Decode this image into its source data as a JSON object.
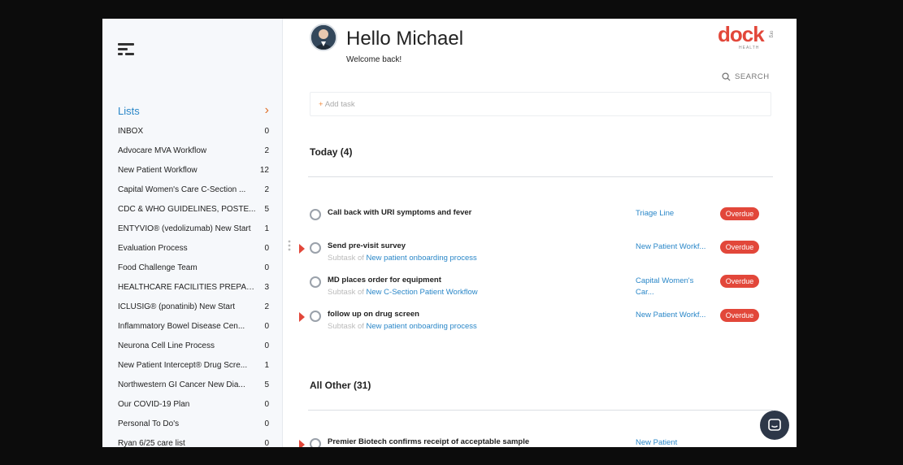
{
  "sidebar": {
    "lists_label": "Lists",
    "items": [
      {
        "name": "INBOX",
        "count": "0"
      },
      {
        "name": "Advocare MVA Workflow",
        "count": "2"
      },
      {
        "name": "New Patient Workflow",
        "count": "12"
      },
      {
        "name": "Capital Women's Care C-Section ...",
        "count": "2"
      },
      {
        "name": "CDC & WHO GUIDELINES, POSTE...",
        "count": "5"
      },
      {
        "name": "ENTYVIO® (vedolizumab) New Start",
        "count": "1"
      },
      {
        "name": "Evaluation Process",
        "count": "0"
      },
      {
        "name": "Food Challenge Team",
        "count": "0"
      },
      {
        "name": "HEALTHCARE FACILITIES PREPAR...",
        "count": "3"
      },
      {
        "name": "ICLUSIG® (ponatinib) New Start",
        "count": "2"
      },
      {
        "name": "Inflammatory Bowel Disease Cen...",
        "count": "0"
      },
      {
        "name": "Neurona Cell Line Process",
        "count": "0"
      },
      {
        "name": "New Patient Intercept® Drug Scre...",
        "count": "1"
      },
      {
        "name": "Northwestern GI Cancer New Dia...",
        "count": "5"
      },
      {
        "name": "Our COVID-19 Plan",
        "count": "0"
      },
      {
        "name": "Personal To Do's",
        "count": "0"
      },
      {
        "name": "Ryan 6/25 care list",
        "count": "0"
      }
    ]
  },
  "header": {
    "greeting": "Hello Michael",
    "welcome": "Welcome back!",
    "logo_text": "dock",
    "logo_sub": "HEALTH",
    "logo_dot": "org",
    "search_label": "SEARCH",
    "add_task_plus": "+",
    "add_task_label": "Add task"
  },
  "sections": {
    "today": "Today (4)",
    "all_other": "All Other (31)"
  },
  "tasks": [
    {
      "title": "Call back with URI symptoms and fever",
      "subtask_prefix": "",
      "subtask_link": "",
      "list": "Triage Line",
      "status": "Overdue",
      "flagged": false
    },
    {
      "title": "Send pre-visit survey",
      "subtask_prefix": "Subtask of",
      "subtask_link": "New patient onboarding process",
      "list": "New Patient Workf...",
      "status": "Overdue",
      "flagged": true
    },
    {
      "title": "MD places order for equipment",
      "subtask_prefix": "Subtask of",
      "subtask_link": "New C-Section Patient Workflow",
      "list": "Capital Women's Car...",
      "status": "Overdue",
      "flagged": false
    },
    {
      "title": "follow up on drug screen",
      "subtask_prefix": "Subtask of",
      "subtask_link": "New patient onboarding process",
      "list": "New Patient Workf...",
      "status": "Overdue",
      "flagged": true
    }
  ],
  "other_tasks": [
    {
      "title": "Premier Biotech confirms receipt of acceptable sample",
      "list": "New Patient",
      "flagged": true
    }
  ],
  "colors": {
    "accent_blue": "#2a87c8",
    "overdue_red": "#e2473a",
    "chevron_orange": "#e0702a"
  },
  "icons": {
    "menu": "menu-icon",
    "search": "search-icon",
    "chat": "chat-icon",
    "chevron": "chevron-right-icon"
  }
}
